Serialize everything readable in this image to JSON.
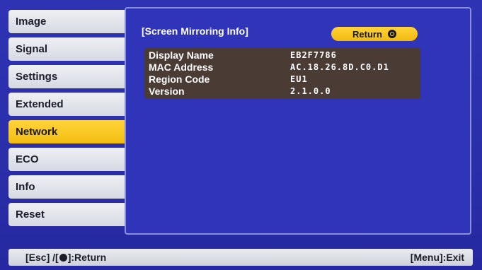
{
  "menu": {
    "items": [
      {
        "label": "Image",
        "active": false
      },
      {
        "label": "Signal",
        "active": false
      },
      {
        "label": "Settings",
        "active": false
      },
      {
        "label": "Extended",
        "active": false
      },
      {
        "label": "Network",
        "active": true
      },
      {
        "label": "ECO",
        "active": false
      },
      {
        "label": "Info",
        "active": false
      },
      {
        "label": "Reset",
        "active": false
      }
    ]
  },
  "panel": {
    "title": "[Screen Mirroring Info]",
    "return_label": "Return",
    "rows": [
      {
        "label": "Display Name",
        "value": "EB2F7786"
      },
      {
        "label": "MAC Address",
        "value": "AC.18.26.8D.C0.D1"
      },
      {
        "label": "Region Code",
        "value": "EU1"
      },
      {
        "label": "Version",
        "value": "2.1.0.0"
      }
    ]
  },
  "footer": {
    "esc_text": "[Esc] /[",
    "return_text": "]:Return",
    "exit_text": "[Menu]:Exit"
  },
  "colors": {
    "background": "#2e33b4",
    "accent": "#ffd43a"
  }
}
